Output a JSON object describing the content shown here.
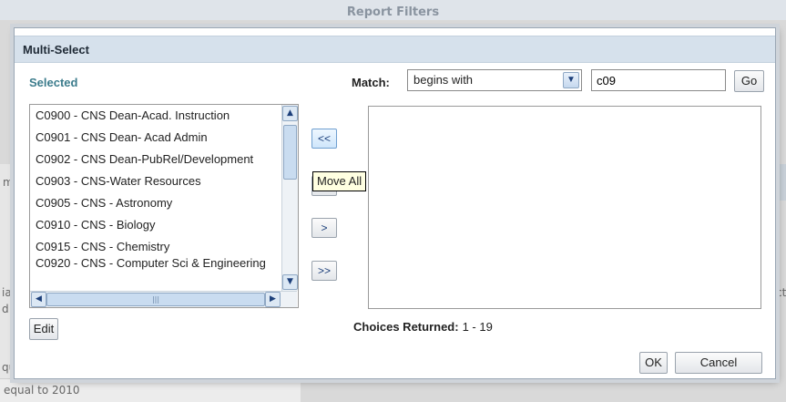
{
  "background": {
    "header_title": "Report Filters",
    "fragments": [
      "m",
      "ia",
      "d t",
      "qu",
      "equal to 2010",
      "ct"
    ]
  },
  "dialog": {
    "title": "Multi-Select",
    "selected_label": "Selected",
    "selected_items": [
      "C0900 - CNS Dean-Acad. Instruction",
      "C0901 - CNS Dean- Acad Admin",
      "C0902 - CNS Dean-PubRel/Development",
      "C0903 - CNS-Water Resources",
      "C0905 - CNS - Astronomy",
      "C0910 - CNS - Biology",
      "C0915 - CNS - Chemistry",
      "C0920 - CNS - Computer Sci & Engineering"
    ],
    "buttons": {
      "remove_all": "<<",
      "remove": "<",
      "add": ">",
      "add_all": ">>",
      "edit": "Edit",
      "go": "Go",
      "ok": "OK",
      "cancel": "Cancel"
    },
    "tooltip": "Move All",
    "match": {
      "label": "Match:",
      "operator": "begins with",
      "value": "c09"
    },
    "choices_returned": {
      "label": "Choices Returned:",
      "value": "1 - 19"
    }
  }
}
